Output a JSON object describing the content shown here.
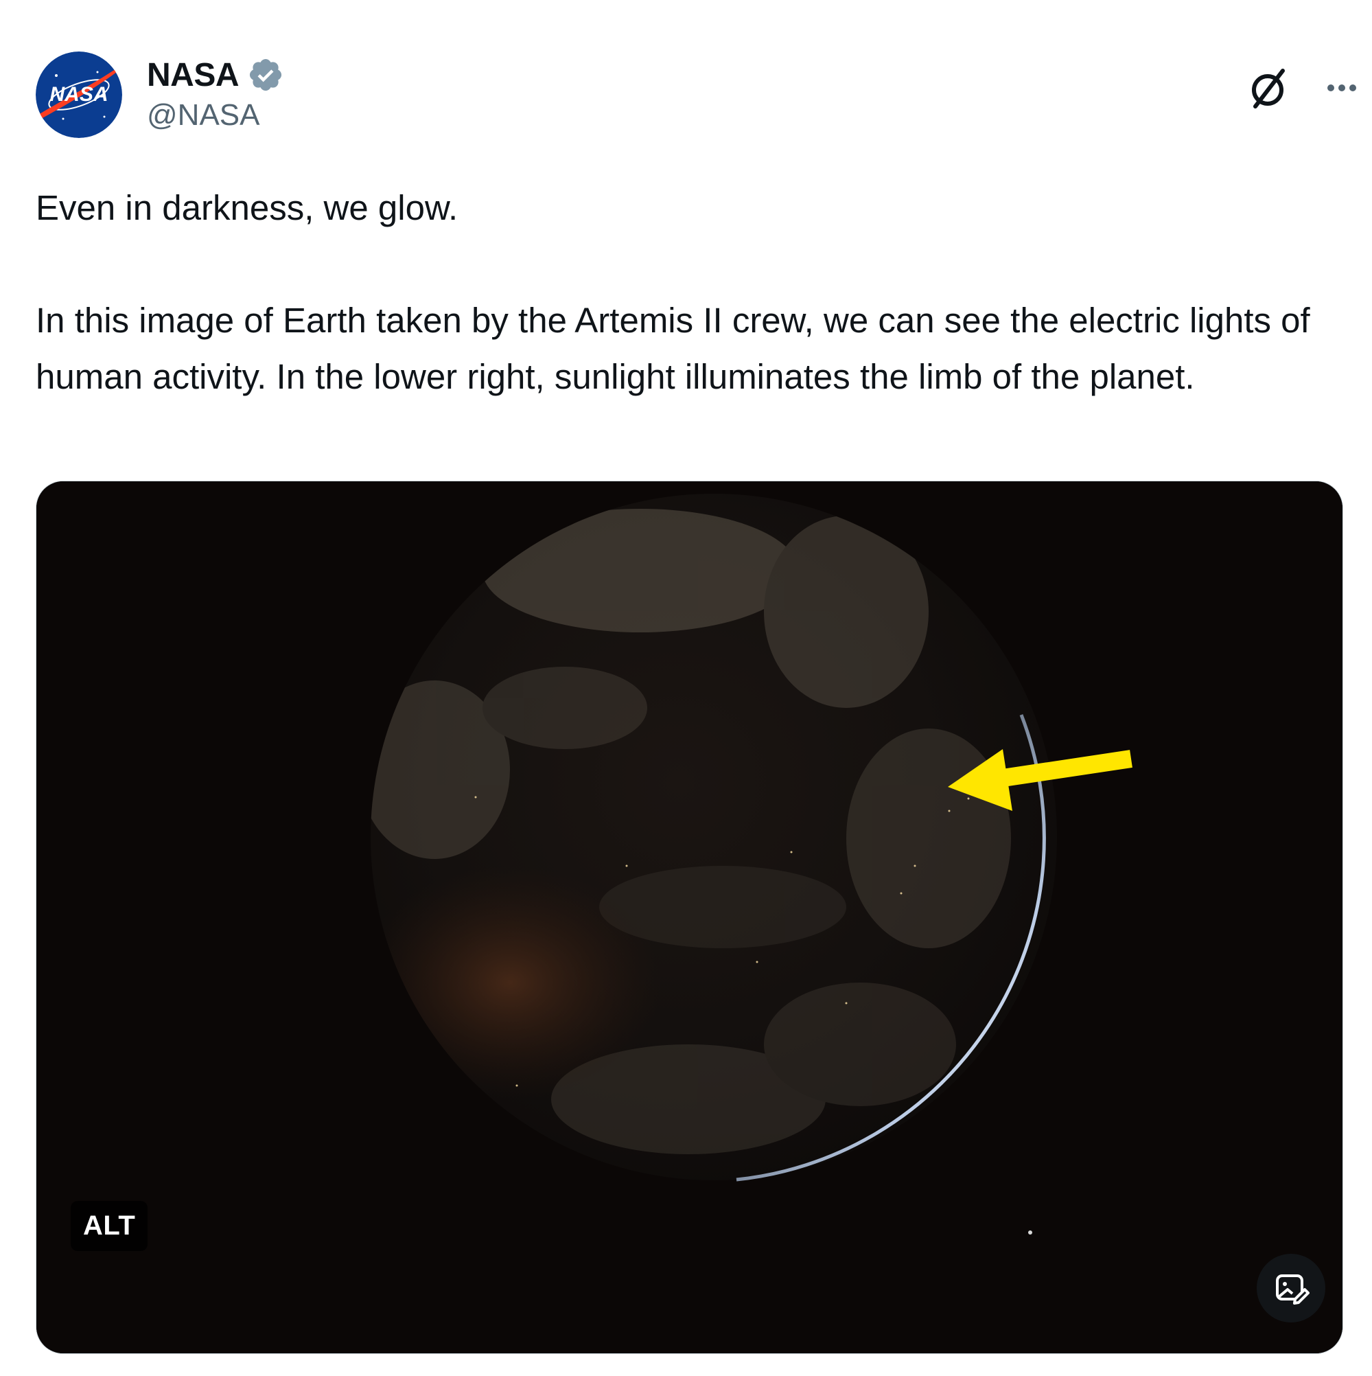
{
  "author": {
    "display_name": "NASA",
    "handle": "@NASA",
    "avatar_text": "NASA",
    "verified_icon": "verified-badge-icon"
  },
  "actions": {
    "grok_icon": "grok-icon",
    "more_icon": "more-options-icon"
  },
  "tweet": {
    "line1": "Even in darkness, we glow.",
    "paragraph2": "In this image of Earth taken by the Artemis II crew, we can see the electric lights of human activity. In the lower right, sunlight illuminates the limb of the planet."
  },
  "media": {
    "alt_label": "ALT",
    "edit_icon": "image-edit-icon",
    "annotation_icon": "yellow-arrow-icon"
  },
  "colors": {
    "handle": "#536471",
    "verified": "#829aab",
    "space": "#0b0706",
    "annotation": "#ffe600",
    "nasa_blue": "#0b3d91",
    "nasa_red": "#fc3d21"
  }
}
